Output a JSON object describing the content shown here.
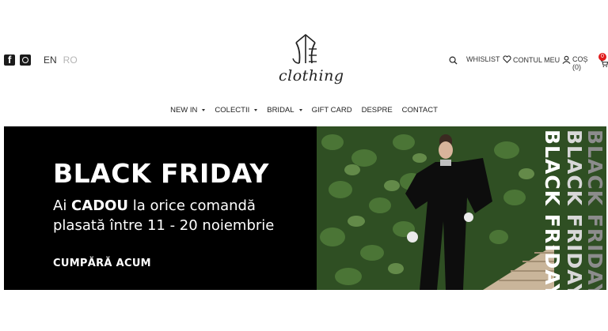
{
  "header": {
    "social": [
      {
        "icon": "facebook-icon"
      },
      {
        "icon": "instagram-icon"
      }
    ],
    "languages": {
      "active": "EN",
      "inactive": "RO"
    },
    "logo_text": "clothing",
    "utility": {
      "wishlist_label": "WHISLIST",
      "account_label": "CONTUL MEU",
      "cart_label": "COȘ (0)",
      "cart_badge": "0"
    }
  },
  "nav": {
    "items": [
      {
        "label": "NEW IN"
      },
      {
        "label": "COLECTII"
      },
      {
        "label": "BRIDAL"
      },
      {
        "label": "GIFT CARD"
      },
      {
        "label": "DESPRE"
      },
      {
        "label": "CONTACT"
      }
    ]
  },
  "hero": {
    "title": "BLACK FRIDAY",
    "subtitle_prefix": "Ai ",
    "subtitle_bold": "CADOU",
    "subtitle_rest": " la orice comandă plasată între 11 - 20 noiembrie",
    "cta": "CUMPĂRĂ ACUM",
    "vertical_text": "BLACK FRIDAY",
    "colors": {
      "background": "#000000",
      "text": "#ffffff",
      "badge": "#e01b1b"
    }
  }
}
